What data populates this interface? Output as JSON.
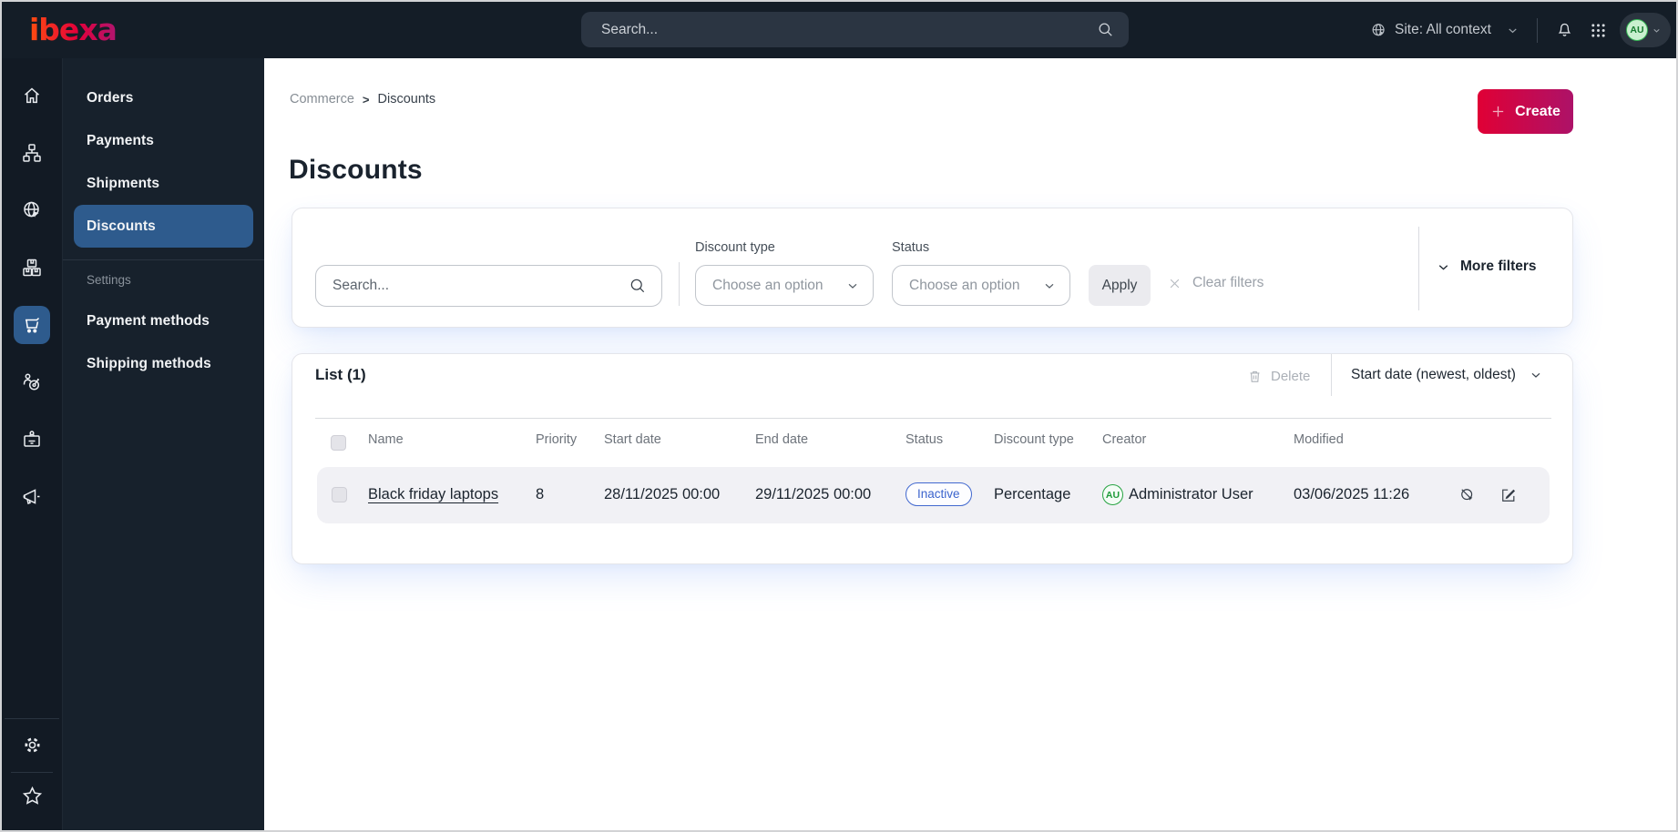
{
  "topbar": {
    "logo": "ibexa",
    "search_placeholder": "Search...",
    "site_context": "Site: All context",
    "avatar_initials": "AU"
  },
  "sidebar": {
    "menu": {
      "items": [
        "Orders",
        "Payments",
        "Shipments",
        "Discounts"
      ],
      "active_item": "Discounts",
      "section_label": "Settings",
      "settings_items": [
        "Payment methods",
        "Shipping methods"
      ]
    }
  },
  "breadcrumb": {
    "items": [
      "Commerce",
      "Discounts"
    ],
    "separator": ">"
  },
  "page": {
    "title": "Discounts",
    "create_label": "Create"
  },
  "filters": {
    "search_placeholder": "Search...",
    "discount_type_label": "Discount type",
    "status_label": "Status",
    "choose_option": "Choose an option",
    "apply_label": "Apply",
    "clear_label": "Clear filters",
    "more_filters_label": "More filters"
  },
  "list": {
    "title": "List (1)",
    "delete_label": "Delete",
    "sort_label": "Start date (newest, oldest)",
    "columns": [
      "Name",
      "Priority",
      "Start date",
      "End date",
      "Status",
      "Discount type",
      "Creator",
      "Modified"
    ],
    "rows": [
      {
        "name": "Black friday laptops",
        "priority": "8",
        "start_date": "28/11/2025 00:00",
        "end_date": "29/11/2025 00:00",
        "status": "Inactive",
        "discount_type": "Percentage",
        "creator_initials": "AU",
        "creator": "Administrator User",
        "modified": "03/06/2025 11:26"
      }
    ]
  },
  "colors": {
    "accent_gradient_start": "#e00035",
    "accent_gradient_end": "#ad1268",
    "active_blue": "#2e5b8d",
    "status_badge_blue": "#3a63cd",
    "creator_green": "#27a342"
  }
}
